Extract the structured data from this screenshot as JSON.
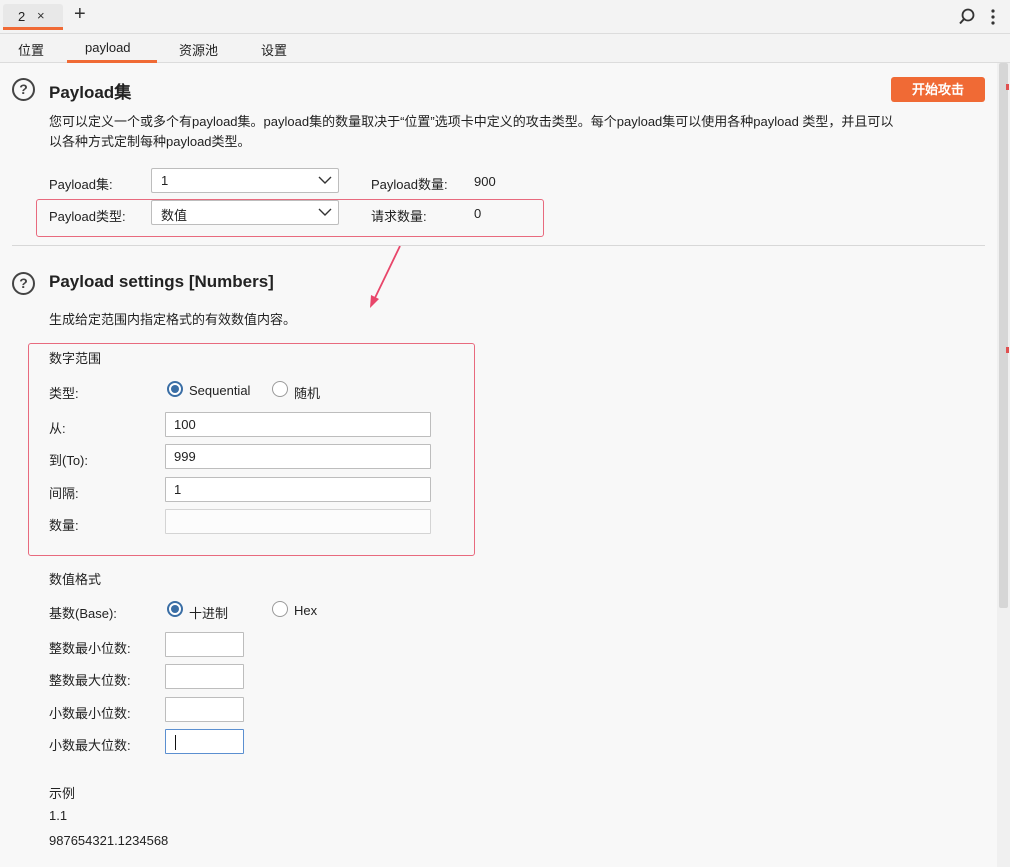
{
  "tabs": {
    "request_tab": "2",
    "close": "×",
    "add": "+"
  },
  "subtabs": [
    "位置",
    "payload",
    "资源池",
    "设置"
  ],
  "payload_sets": {
    "title": "Payload集",
    "start_attack": "开始攻击",
    "description_line1": "您可以定义一个或多个有payload集。payload集的数量取决于“位置”选项卡中定义的攻击类型。每个payload集可以使用各种payload 类型，并且可以",
    "description_line2": "以各种方式定制每种payload类型。",
    "set_label": "Payload集:",
    "set_value": "1",
    "count_label": "Payload数量:",
    "count_value": "900",
    "type_label": "Payload类型:",
    "type_value": "数值",
    "request_label": "请求数量:",
    "request_value": "0"
  },
  "settings": {
    "title": "Payload settings [Numbers]",
    "description": "生成给定范围内指定格式的有效数值内容。",
    "range_heading": "数字范围",
    "type_label": "类型:",
    "type_options": [
      "Sequential",
      "随机"
    ],
    "from_label": "从:",
    "from_value": "100",
    "to_label": "到(To):",
    "to_value": "999",
    "step_label": "间隔:",
    "step_value": "1",
    "count_label": "数量:",
    "count_value": "",
    "format_heading": "数值格式",
    "base_label": "基数(Base):",
    "base_options": [
      "十进制",
      "Hex"
    ],
    "min_int_label": "整数最小位数:",
    "max_int_label": "整数最大位数:",
    "min_frac_label": "小数最小位数:",
    "max_frac_label": "小数最大位数:",
    "example_heading": "示例",
    "example1": "1.1",
    "example2": "987654321.1234568"
  },
  "colors": {
    "accent": "#f06a35",
    "highlight_box": "#e86a7e",
    "radio": "#3a6ea5"
  }
}
